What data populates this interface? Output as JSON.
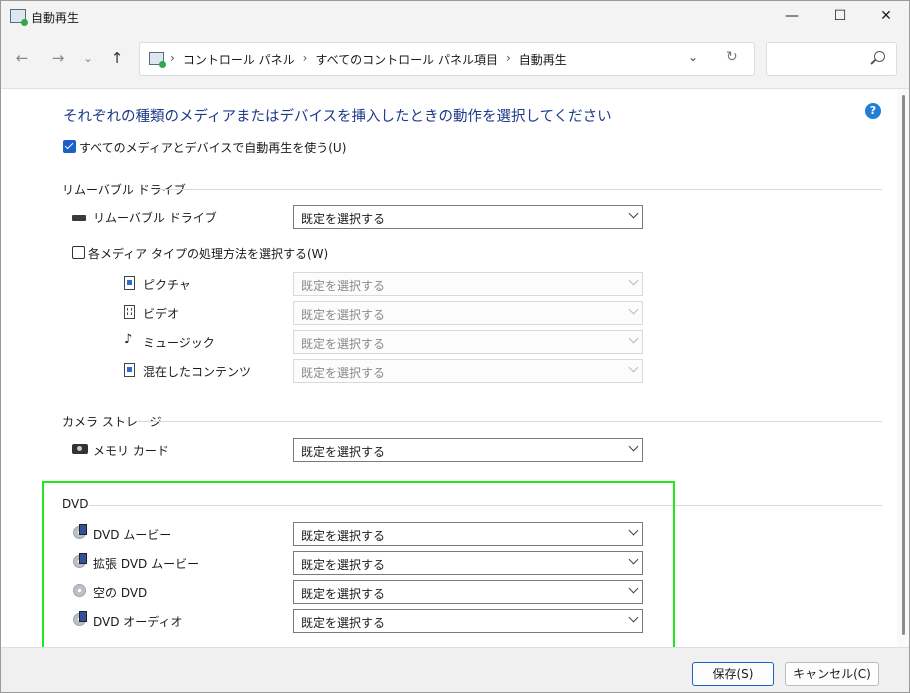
{
  "window": {
    "title": "自動再生",
    "minimize": "—",
    "maximize": "☐",
    "close": "✕"
  },
  "nav": {
    "back": "←",
    "forward": "→",
    "recent": "⌄",
    "up": "↑",
    "breadcrumb": [
      "コントロール パネル",
      "すべてのコントロール パネル項目",
      "自動再生"
    ],
    "separator": "›",
    "dropdown": "⌄",
    "refresh": "↻",
    "search_placeholder": ""
  },
  "heading": "それぞれの種類のメディアまたはデバイスを挿入したときの動作を選択してください",
  "help_label": "?",
  "use_autoplay": {
    "label": "すべてのメディアとデバイスで自動再生を使う(U)",
    "checked": true
  },
  "default_option": "既定を選択する",
  "sections": {
    "removable": {
      "title": "リムーバブル ドライブ",
      "drive_label": "リムーバブル ドライブ",
      "per_media": {
        "label": "各メディア タイプの処理方法を選択する(W)",
        "checked": false
      },
      "media_types": [
        "ピクチャ",
        "ビデオ",
        "ミュージック",
        "混在したコンテンツ"
      ]
    },
    "camera": {
      "title": "カメラ ストレージ",
      "items": [
        "メモリ カード"
      ]
    },
    "dvd": {
      "title": "DVD",
      "items": [
        "DVD ムービー",
        "拡張 DVD ムービー",
        "空の DVD",
        "DVD オーディオ"
      ]
    }
  },
  "footer": {
    "save": "保存(S)",
    "cancel": "キャンセル(C)"
  },
  "colors": {
    "heading": "#1e3a8a",
    "accent": "#1a62c7",
    "highlight_box": "#1ee81e"
  }
}
